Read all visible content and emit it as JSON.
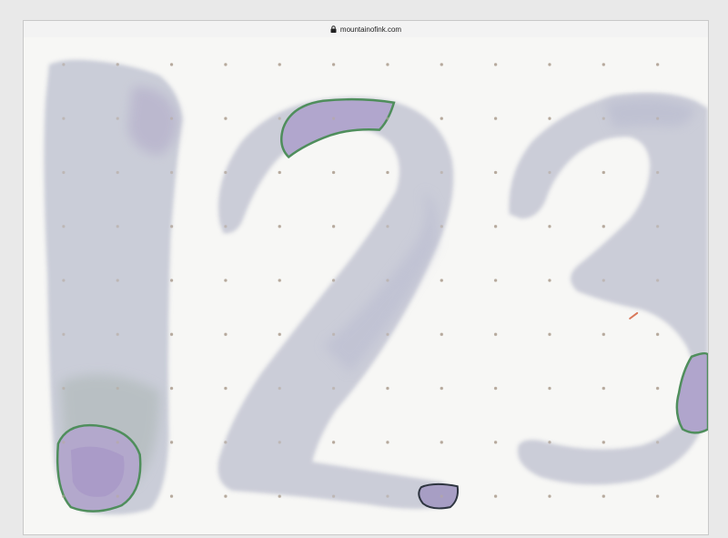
{
  "browser": {
    "url": "mountainofink.com",
    "lock_icon": "lock-icon"
  },
  "image": {
    "subject": "ink-swab-numerals",
    "numerals": [
      "1",
      "2",
      "3"
    ],
    "paper": "dot-grid",
    "colors": {
      "ink_wash": "#c9cbd8",
      "ink_dark": "#b3abc8",
      "sheen_green": "#4f8e5c",
      "dot": "#b6a99c",
      "paper": "#f7f7f5"
    }
  }
}
